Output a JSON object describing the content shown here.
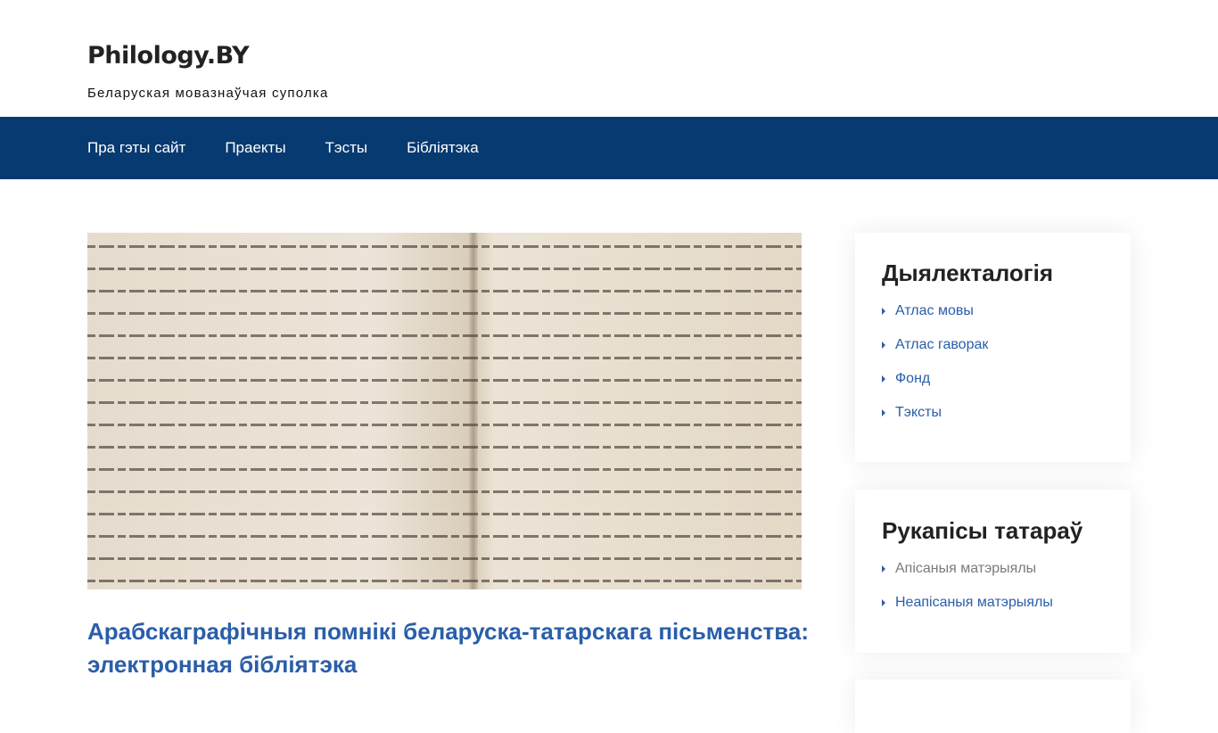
{
  "site": {
    "title": "Philology.BY",
    "tagline": "Беларуская мовазнаўчая суполка"
  },
  "nav": [
    "Пра гэты сайт",
    "Праекты",
    "Тэсты",
    "Бібліятэка"
  ],
  "post": {
    "title": "Арабскаграфічныя помнікі беларуска-татарскага пісьменства: электронная бібліятэка"
  },
  "widgets": [
    {
      "title": "Дыялекталогія",
      "items": [
        "Атлас мовы",
        "Атлас гаворак",
        "Фонд",
        "Тэксты"
      ]
    },
    {
      "title": "Рукапісы татараў",
      "items": [
        "Апісаныя матэрыялы",
        "Неапісаныя матэрыялы"
      ]
    }
  ]
}
